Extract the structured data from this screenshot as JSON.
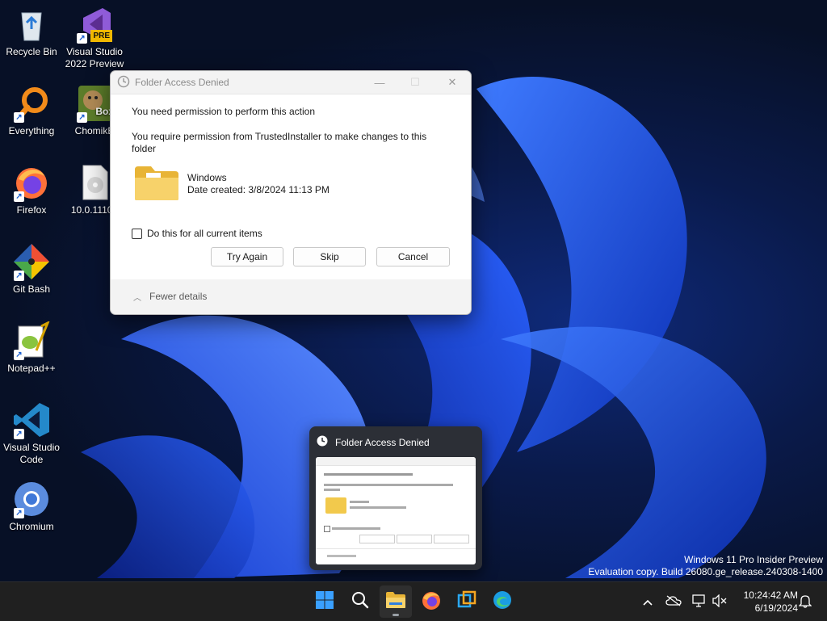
{
  "desktop": {
    "icons": [
      {
        "label": "Recycle Bin",
        "icon": "recycle-bin-icon"
      },
      {
        "label": "Visual Studio 2022 Preview",
        "icon": "visual-studio-preview-icon",
        "badge": "PRE"
      },
      {
        "label": "Everything",
        "icon": "everything-search-icon"
      },
      {
        "label": "ChomikBox",
        "icon": "chomikbox-icon",
        "badge": "Box"
      },
      {
        "label": "Firefox",
        "icon": "firefox-icon"
      },
      {
        "label": "10.0.11102",
        "icon": "disc-image-file-icon"
      },
      {
        "label": "Git Bash",
        "icon": "git-bash-icon"
      },
      {
        "label": "Notepad++",
        "icon": "notepad-plus-plus-icon"
      },
      {
        "label": "Visual Studio Code",
        "icon": "vscode-icon"
      },
      {
        "label": "Chromium",
        "icon": "chromium-icon"
      }
    ],
    "chomik_visible_label": "ChomikB",
    "iso_visible_label": "10.0.11102"
  },
  "dialog": {
    "title": "Folder Access Denied",
    "message": "You need permission to perform this action",
    "detail": "You require permission from TrustedInstaller to make changes to this folder",
    "item_name": "Windows",
    "item_date": "Date created: 3/8/2024 11:13 PM",
    "checkbox_label": "Do this for all current items",
    "checkbox_checked": false,
    "buttons": {
      "try_again": "Try Again",
      "skip": "Skip",
      "cancel": "Cancel"
    },
    "details_toggle": "Fewer details",
    "controls": {
      "minimize": "—",
      "maximize": "☐",
      "close": "✕"
    }
  },
  "thumbnail": {
    "title": "Folder Access Denied"
  },
  "watermark": {
    "line1": "Windows 11 Pro Insider Preview",
    "line2": "Evaluation copy. Build 26080.ge_release.240308-1400"
  },
  "taskbar": {
    "apps": [
      {
        "name": "start",
        "icon": "windows-start-icon"
      },
      {
        "name": "search",
        "icon": "search-icon"
      },
      {
        "name": "file-explorer",
        "icon": "file-explorer-icon",
        "active": true
      },
      {
        "name": "firefox",
        "icon": "firefox-icon"
      },
      {
        "name": "virtualbox",
        "icon": "virtualbox-icon"
      },
      {
        "name": "edge",
        "icon": "edge-icon"
      }
    ],
    "clock": {
      "time": "10:24:42 AM",
      "date": "6/19/2024"
    }
  },
  "colors": {
    "accent": "#0067c0",
    "folder": "#f2c94c",
    "taskbar": "#202020",
    "wallpaper_blue": "#1e4fe0"
  }
}
